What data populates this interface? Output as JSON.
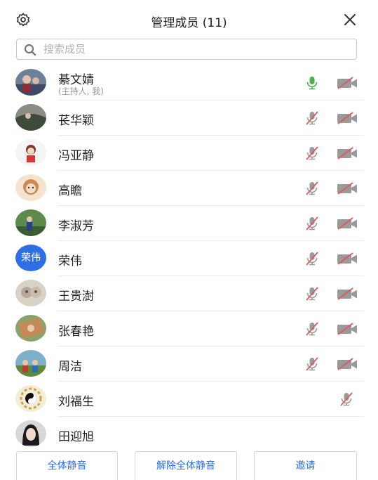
{
  "header": {
    "title": "管理成员 (11)",
    "settings_icon": "gear-icon",
    "close_icon": "close-icon"
  },
  "search": {
    "placeholder": "搜索成员",
    "value": ""
  },
  "colors": {
    "accent": "#2f6fe6",
    "mic_active": "#4caf50",
    "muted_slash": "#e05a5a",
    "icon_gray": "#9a9a9a"
  },
  "members": [
    {
      "name": "綦文婧",
      "role": "(主持人, 我)",
      "mic": "on",
      "camera": "off"
    },
    {
      "name": "苌华颖",
      "mic": "muted",
      "camera": "off"
    },
    {
      "name": "冯亚静",
      "mic": "muted",
      "camera": "off"
    },
    {
      "name": "高瞻",
      "mic": "muted",
      "camera": "off"
    },
    {
      "name": "李淑芳",
      "mic": "muted",
      "camera": "off"
    },
    {
      "name": "荣伟",
      "avatar_text": "荣伟",
      "mic": "muted",
      "camera": "off"
    },
    {
      "name": "王贵澍",
      "mic": "muted",
      "camera": "off"
    },
    {
      "name": "张春艳",
      "mic": "muted",
      "camera": "off"
    },
    {
      "name": "周洁",
      "mic": "muted",
      "camera": "off"
    },
    {
      "name": "刘福生",
      "mic": "muted"
    },
    {
      "name": "田迎旭"
    }
  ],
  "footer": {
    "mute_all": "全体静音",
    "unmute_all": "解除全体静音",
    "invite": "邀请"
  }
}
